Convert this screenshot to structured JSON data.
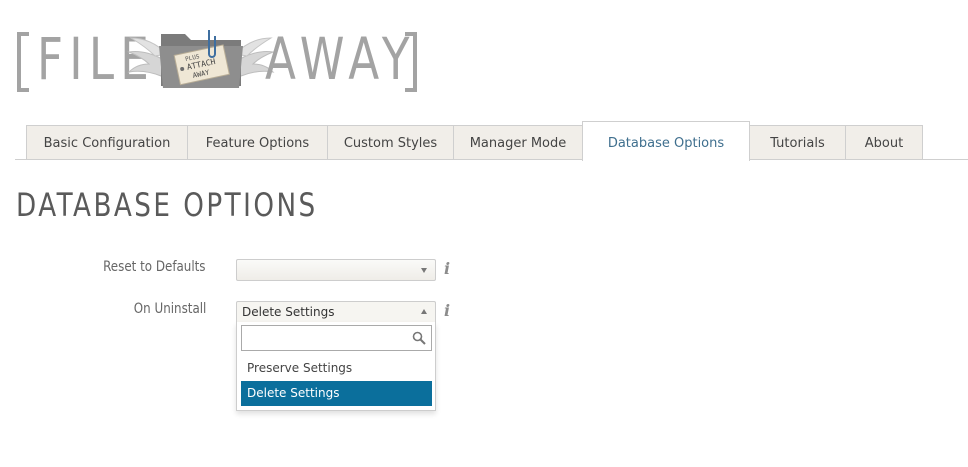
{
  "logo": {
    "left_word": "FILE",
    "right_word": "AWAY",
    "tag_lines": [
      "PLUS",
      "ATTACH",
      "AWAY"
    ],
    "icon": "winged-folder-icon"
  },
  "tabs": [
    {
      "label": "Basic Configuration",
      "active": false
    },
    {
      "label": "Feature Options",
      "active": false
    },
    {
      "label": "Custom Styles",
      "active": false
    },
    {
      "label": "Manager Mode",
      "active": false
    },
    {
      "label": "Database Options",
      "active": true
    },
    {
      "label": "Tutorials",
      "active": false
    },
    {
      "label": "About",
      "active": false
    }
  ],
  "page": {
    "title": "DATABASE OPTIONS"
  },
  "form": {
    "reset_defaults": {
      "label": "Reset to Defaults",
      "value": "",
      "info_icon": "info-icon"
    },
    "on_uninstall": {
      "label": "On Uninstall",
      "value": "Delete Settings",
      "info_icon": "info-icon",
      "dropdown_open": true,
      "search_value": "",
      "options": [
        {
          "label": "Preserve Settings",
          "highlighted": false
        },
        {
          "label": "Delete Settings",
          "highlighted": true
        }
      ]
    }
  },
  "colors": {
    "tab_background": "#f1eee9",
    "active_tab_text": "#3f6f8e",
    "highlight": "#0b6f9c",
    "logo_grey": "#a3a3a3"
  }
}
